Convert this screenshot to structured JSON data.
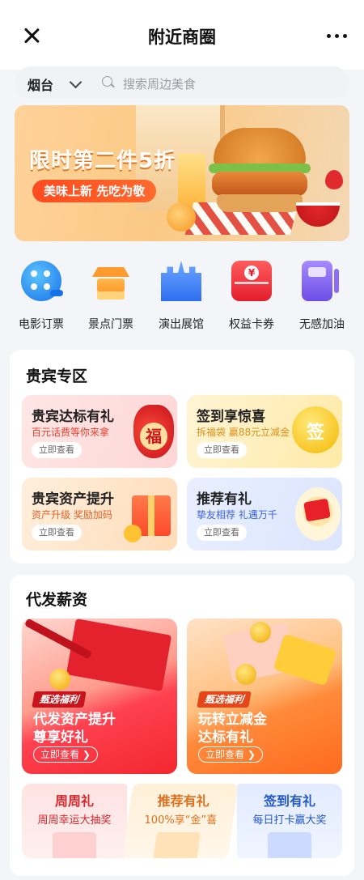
{
  "header": {
    "title": "附近商圈"
  },
  "search": {
    "city": "烟台",
    "placeholder": "搜索周边美食"
  },
  "banner": {
    "title": "限时第二件5折",
    "subtitle": "美味上新 先吃为敬"
  },
  "quick_icons": [
    {
      "label": "电影订票",
      "icon": "film-reel-icon"
    },
    {
      "label": "景点门票",
      "icon": "pavilion-icon"
    },
    {
      "label": "演出展馆",
      "icon": "castle-icon"
    },
    {
      "label": "权益卡券",
      "icon": "coupon-card-icon"
    },
    {
      "label": "无感加油",
      "icon": "fuel-pump-icon"
    }
  ],
  "vip": {
    "title": "贵宾专区",
    "tiles": [
      {
        "title": "贵宾达标有礼",
        "subtitle": "百元话费等你来拿",
        "button": "立即查看",
        "sub_color": "#e5422f",
        "deco_text": "福"
      },
      {
        "title": "签到享惊喜",
        "subtitle": "拆福袋 赢88元立减金",
        "button": "立即查看",
        "sub_color": "#d9901a",
        "deco_text": "签"
      },
      {
        "title": "贵宾资产提升",
        "subtitle": "资产升级 奖励加码",
        "button": "立即查看",
        "sub_color": "#e5632b"
      },
      {
        "title": "推荐有礼",
        "subtitle": "挚友相荐 礼遇万千",
        "button": "立即查看",
        "sub_color": "#3b63d9"
      }
    ]
  },
  "payroll": {
    "title": "代发薪资",
    "promos": [
      {
        "tag": "甄选福利",
        "line1": "代发资产提升",
        "line2": "尊享好礼",
        "button": "立即查看 ❯"
      },
      {
        "tag": "甄选福利",
        "line1": "玩转立减金",
        "line2": "达标有礼",
        "button": "立即查看 ❯"
      }
    ],
    "mini": [
      {
        "title": "周周礼",
        "subtitle": "周周幸运大抽奖",
        "color": "#d6282c"
      },
      {
        "title": "推荐有礼",
        "subtitle": "100%享“金”喜",
        "color": "#e0701e"
      },
      {
        "title": "签到有礼",
        "subtitle": "每日打卡赢大奖",
        "color": "#2458c9"
      }
    ]
  },
  "colors": {
    "accent_red": "#e31d2d",
    "accent_orange": "#ff6a1e",
    "page_bg": "#f4f5f8"
  }
}
